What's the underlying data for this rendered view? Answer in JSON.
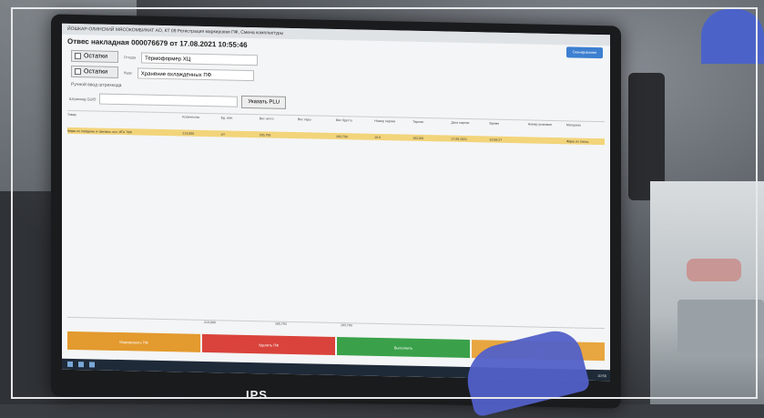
{
  "screen": {
    "title": "ЙОШКАР-ОЛИНСКИЙ МЯСОКОМБИНАТ АО, КТ 09 Регистрация маркировки ПФ, Смена комплектуры",
    "invoice": "Отвес накладная 000076679 от 17.08.2021 10:55:46",
    "top_button": "Сканирование",
    "row1": {
      "button": "Остатки",
      "label": "Откуда",
      "value": "Термоформер ХЦ"
    },
    "row2": {
      "button": "Остатки",
      "label": "Куда",
      "value": "Хранение охлажденных ПФ"
    },
    "manual_input": "Ручной ввод штрихкода",
    "barcode_label": "Штрихкод GUID",
    "plu_button": "Указать PLU",
    "table": {
      "headers": [
        "Товар",
        "Количество",
        "Ед. изм.",
        "Вес нетто",
        "Вес тары",
        "Вес брутто",
        "Номер партии",
        "Тарная",
        "Дата партии",
        "Время",
        "Номер упаковки",
        "Материал"
      ],
      "row": [
        "Фарш из говядины и свинины охл. ИГА 700г",
        "213,000",
        "шт",
        "165,793",
        "",
        "183,700",
        "10.0",
        "102100",
        "17.08.2021",
        "10:56:27",
        "",
        "Фарш из глины"
      ]
    },
    "totals": {
      "qty": "213,000",
      "net": "165,793",
      "gross": "183,700"
    },
    "buttons": {
      "a": "Маркировать ПФ",
      "b": "Удалить ПФ",
      "c": "Выполнить",
      "d": "Закрыть"
    },
    "taskbar_time": "10:56"
  },
  "bottom_caption": "IPS"
}
